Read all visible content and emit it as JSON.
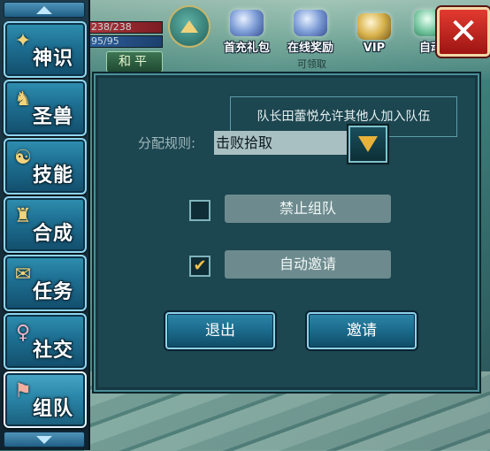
{
  "sidebar": {
    "items": [
      {
        "label": "神识"
      },
      {
        "label": "圣兽"
      },
      {
        "label": "技能"
      },
      {
        "label": "合成"
      },
      {
        "label": "任务"
      },
      {
        "label": "社交"
      },
      {
        "label": "组队"
      }
    ]
  },
  "hud": {
    "hp_text": "238/238",
    "mp_text": "95/95",
    "mode_button": "和平",
    "icons": [
      {
        "label": "首充礼包"
      },
      {
        "label": "在线奖励"
      },
      {
        "label": "VIP"
      },
      {
        "label": "自动"
      }
    ],
    "online_reward_sub": "可领取"
  },
  "dialog": {
    "info_text": "队长田蕾悦允许其他人加入队伍",
    "rule_label": "分配规则:",
    "rule_value": "击败拾取",
    "option_forbid_label": "禁止组队",
    "option_forbid_checked": false,
    "option_auto_label": "自动邀请",
    "option_auto_checked": true,
    "check_mark": "✔",
    "exit_button": "退出",
    "invite_button": "邀请"
  },
  "close_label": "✕"
}
